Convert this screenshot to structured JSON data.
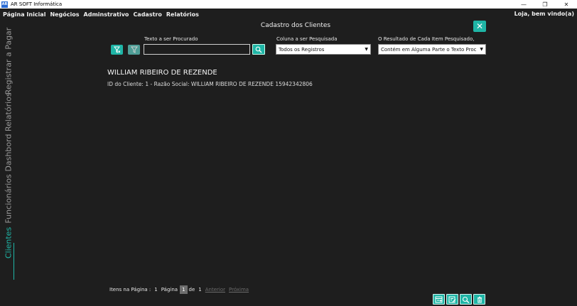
{
  "window": {
    "icon_text": "AR",
    "title": "AR SOFT Informática",
    "minimize": "—",
    "maximize": "❐",
    "close": "✕"
  },
  "menu": {
    "items": [
      "Página Inicial",
      "Negócios",
      "Adminstrativo",
      "Cadastro",
      "Relatórios"
    ],
    "greeting": "Loja, bem vindo(a)"
  },
  "sidebar": {
    "tabs": [
      "Registrar a Pagar",
      "Dashbord Relatórios",
      "Funcionários",
      "Clientes"
    ],
    "active": "Clientes"
  },
  "header": {
    "title": "Cadastro dos Clientes",
    "close_icon": "✕"
  },
  "filters": {
    "text_label": "Texto a ser Procurado",
    "text_value": "",
    "column_label": "Coluna a ser Pesquisada",
    "column_value": "Todos os Registros",
    "match_label": "O Resultado de Cada Item Pesquisado,",
    "match_value": "Contém em Alguma Parte o Texto Procurado"
  },
  "results": [
    {
      "name": "WILLIAM RIBEIRO DE REZENDE",
      "detail": "ID do Cliente: 1 - Razão Social: WILLIAM RIBEIRO DE REZENDE 15942342806"
    }
  ],
  "pagination": {
    "items_label": "Itens na Página :",
    "items_count": "1",
    "page_label": "Página",
    "current_page": "1",
    "of_label": "de",
    "total_pages": "1",
    "prev_label": "Anterior",
    "next_label": "Próxima"
  },
  "colors": {
    "accent": "#1fb5a6",
    "background": "#1e1e1e"
  }
}
